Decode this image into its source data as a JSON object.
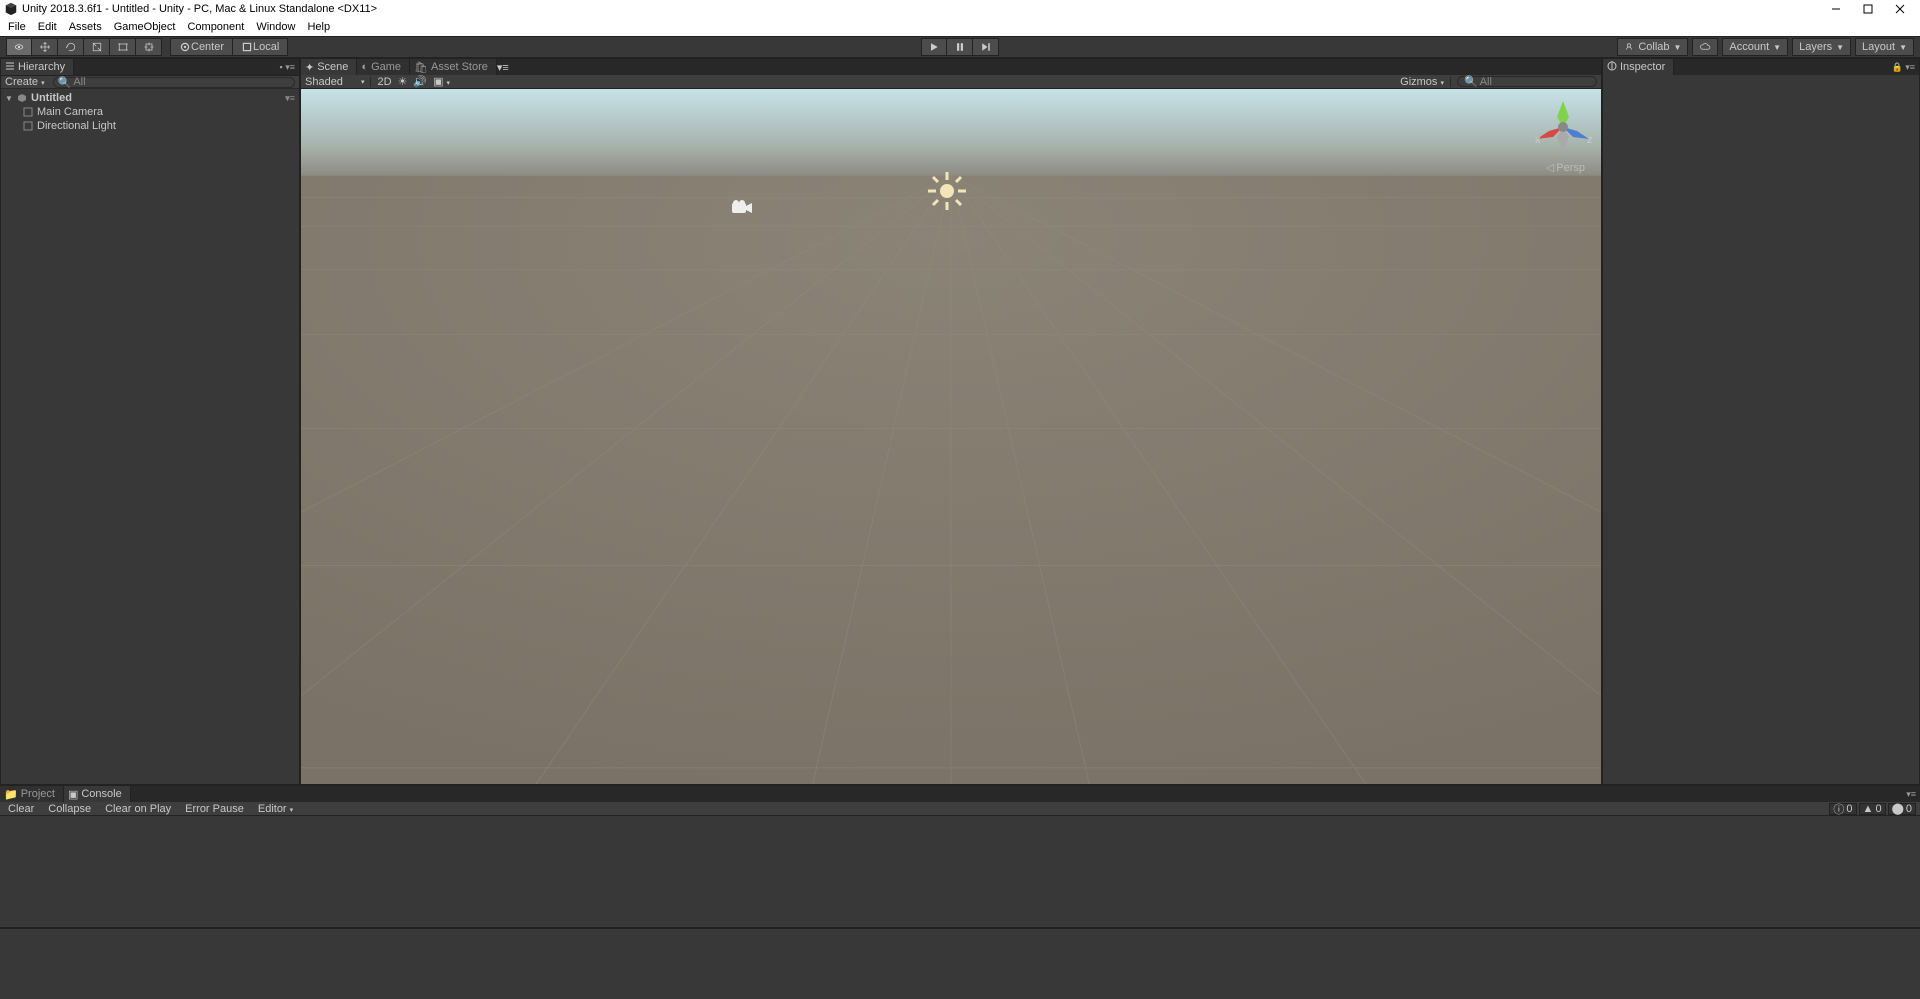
{
  "window": {
    "title": "Unity 2018.3.6f1 - Untitled - Unity - PC, Mac & Linux Standalone <DX11>"
  },
  "menu": {
    "items": [
      "File",
      "Edit",
      "Assets",
      "GameObject",
      "Component",
      "Window",
      "Help"
    ]
  },
  "toolbar": {
    "pivot": "Center",
    "space": "Local",
    "collab": "Collab",
    "account": "Account",
    "layers": "Layers",
    "layout": "Layout"
  },
  "hierarchy": {
    "title": "Hierarchy",
    "create": "Create",
    "search_placeholder": "All",
    "scene": "Untitled",
    "items": [
      "Main Camera",
      "Directional Light"
    ]
  },
  "scene": {
    "tabs": [
      "Scene",
      "Game",
      "Asset Store"
    ],
    "shading": "Shaded",
    "mode2d": "2D",
    "gizmos": "Gizmos",
    "search_placeholder": "All",
    "persp": "Persp",
    "axis_x": "x",
    "axis_z": "z"
  },
  "inspector": {
    "title": "Inspector"
  },
  "bottom": {
    "tabs": [
      "Project",
      "Console"
    ],
    "clear": "Clear",
    "collapse": "Collapse",
    "clear_on_play": "Clear on Play",
    "error_pause": "Error Pause",
    "editor": "Editor",
    "count_info": "0",
    "count_warn": "0",
    "count_err": "0"
  }
}
